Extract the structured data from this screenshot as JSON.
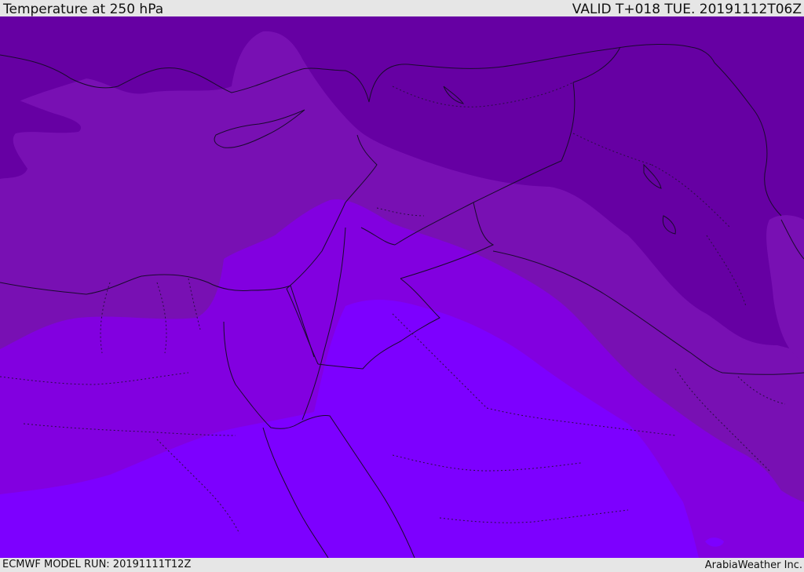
{
  "header": {
    "title": "Temperature at 250 hPa",
    "valid": "VALID T+018 TUE. 20191112T06Z"
  },
  "footer": {
    "model_run": "ECMWF MODEL RUN: 20191111T12Z",
    "credit": "ArabiaWeather Inc."
  },
  "map": {
    "colors": {
      "darkest": "#6600a3",
      "dark": "#7810b3",
      "mid": "#8200e0",
      "light": "#7d00ff",
      "border": "#1a0a2e"
    }
  }
}
